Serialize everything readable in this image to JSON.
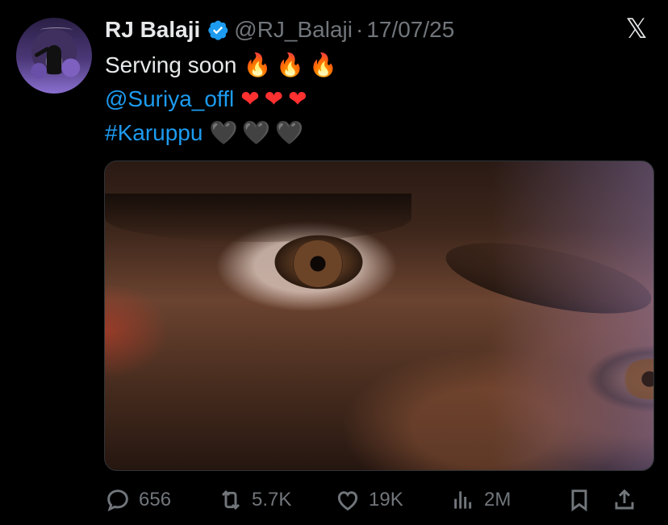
{
  "author": {
    "name": "RJ Balaji",
    "handle": "@RJ_Balaji",
    "separator": "·",
    "date": "17/07/25",
    "verified": true,
    "verified_color": "#1d9bf0"
  },
  "platform_logo": "𝕏",
  "text": {
    "line1": "Serving soon",
    "line1_emojis": "🔥🔥🔥",
    "mention": "@Suriya_offl",
    "line2_emojis": "❤❤❤",
    "hashtag": "#Karuppu",
    "line3_emojis": "🖤🖤🖤"
  },
  "media": {
    "type": "image",
    "icon": "closeup-eyes-photo"
  },
  "actions": {
    "replies": "656",
    "reposts": "5.7K",
    "likes": "19K",
    "views": "2M"
  },
  "colors": {
    "background": "#000000",
    "primary_text": "#e7e9ea",
    "secondary_text": "#71767b",
    "link": "#1d9bf0"
  }
}
